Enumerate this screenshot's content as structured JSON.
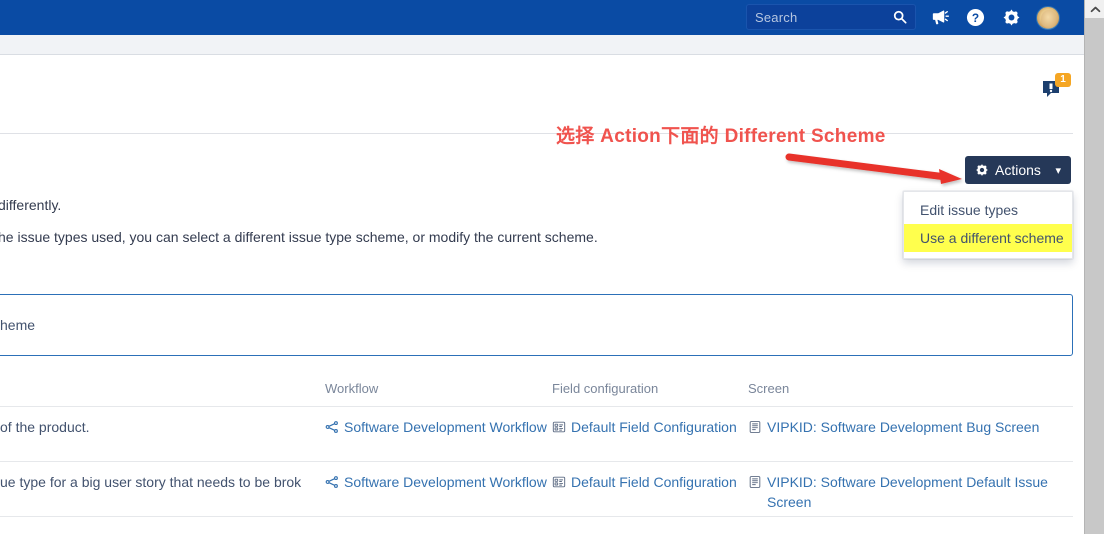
{
  "topbar": {
    "search": {
      "placeholder": "Search",
      "value": "",
      "icon": "search-icon"
    },
    "icons": [
      {
        "name": "megaphone-icon",
        "label": "Announcements"
      },
      {
        "name": "help-icon",
        "label": "Help"
      },
      {
        "name": "gear-icon",
        "label": "Settings"
      },
      {
        "name": "avatar",
        "label": "Profile"
      }
    ]
  },
  "notification": {
    "icon": "feedback-bubble-icon",
    "badge": "1"
  },
  "annotation": {
    "text": "选择 Action下面的 Different Scheme",
    "color": "#f0534e",
    "arrow": "red-arrow-icon"
  },
  "body": {
    "paragraph1": "differently.",
    "paragraph2": "he issue types used, you can select a different issue type scheme, or modify the current scheme."
  },
  "actions": {
    "button_label": "Actions",
    "gear_icon": "gear-icon",
    "caret_icon": "chevron-down-icon",
    "menu": [
      {
        "label": "Edit issue types",
        "highlighted": false
      },
      {
        "label": "Use a different scheme",
        "highlighted": true
      }
    ]
  },
  "infobox": {
    "text": "cheme",
    "border_color": "#2c70b8"
  },
  "table": {
    "columns": [
      "",
      "Workflow",
      "Field configuration",
      "Screen"
    ],
    "rows": [
      {
        "description": "of the product.",
        "workflow": "Software Development Workflow",
        "workflow_icon": "workflow-icon",
        "field_configuration": "Default Field Configuration",
        "field_configuration_icon": "field-config-icon",
        "screen": "VIPKID: Software Development Bug Screen",
        "screen_icon": "screen-icon"
      },
      {
        "description": "ue type for a big user story that needs to be brok",
        "workflow": "Software Development Workflow",
        "workflow_icon": "workflow-icon",
        "field_configuration": "Default Field Configuration",
        "field_configuration_icon": "field-config-icon",
        "screen": "VIPKID: Software Development Default Issue Screen",
        "screen_icon": "screen-icon"
      }
    ]
  },
  "scrollbar": {
    "up_arrow_icon": "chevron-up-icon"
  },
  "colors": {
    "nav_blue": "#0a4ba4",
    "actions_navy": "#253858",
    "link_blue": "#3572b0",
    "highlight_yellow": "#ffff4d",
    "annotation_red": "#f0534e"
  }
}
